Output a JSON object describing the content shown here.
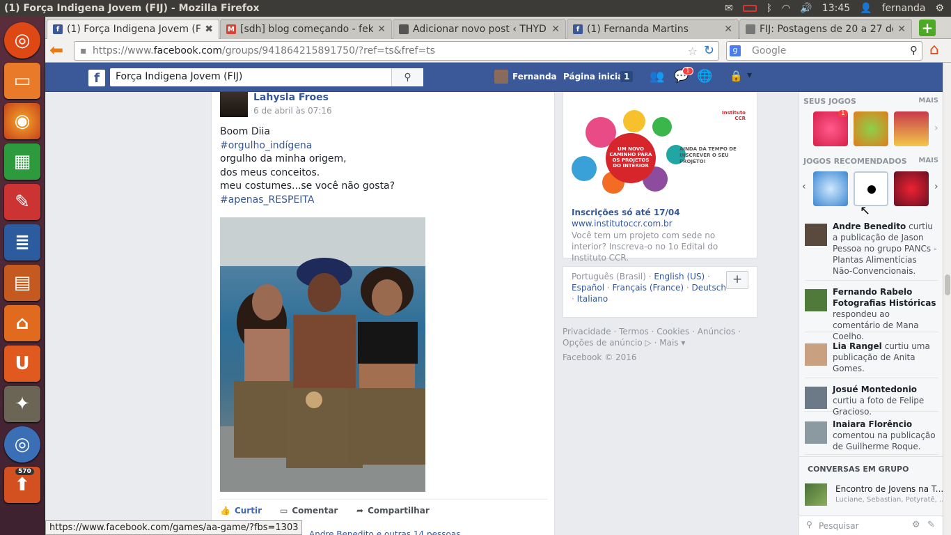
{
  "window": {
    "title": "(1) Força Indigena Jovem (FIJ) - Mozilla Firefox"
  },
  "indicators": {
    "time": "13:45",
    "user": "fernanda"
  },
  "tabs": [
    {
      "label": "(1) Força Indigena Jovem (FIJ)",
      "color": "#3b5998"
    },
    {
      "label": "[sdh] blog começando - fek...",
      "color": "#d44638"
    },
    {
      "label": "Adicionar novo post ‹ THYD...",
      "color": "#555555"
    },
    {
      "label": "(1) Fernanda Martins",
      "color": "#3b5998"
    },
    {
      "label": "FIJ: Postagens de 20 a 27 de...",
      "color": "#777777"
    }
  ],
  "navbar": {
    "url_pre": "https://www.",
    "url_domain": "facebook.com",
    "url_post": "/groups/941864215891750/?ref=ts&fref=ts",
    "search_placeholder": "Google"
  },
  "fb": {
    "search_value": "Força Indigena Jovem (FIJ)",
    "user": "Fernanda",
    "home": "Página inicial",
    "home_count": "1",
    "notif_count": "1"
  },
  "post": {
    "author": "Lahysla Froes",
    "date": "6 de abril às 07:16",
    "lines": [
      "Boom Diia",
      "#orgulho_indígena",
      "orgulho da minha origem,",
      "dos meus conceitos.",
      "meu costumes...se você não gosta?",
      "#apenas_RESPEITA"
    ],
    "like": "Curtir",
    "comment": "Comentar",
    "share": "Compartilhar",
    "likers": "Andre Benedito e outras 14 pessoas"
  },
  "ad": {
    "banner_big": "UM NOVO CAMINHO PARA OS PROJETOS DO INTERIOR",
    "banner_side": "AINDA DÁ TEMPO DE INSCREVER O SEU PROJETO!",
    "brand": "Instituto CCR",
    "title": "Inscrições só até 17/04",
    "url": "www.institutoccr.com.br",
    "desc": "Você tem um projeto com sede no interior? Inscreva-o no 1o Edital do Instituto CCR."
  },
  "languages": {
    "current": "Português (Brasil)",
    "others": [
      "English (US)",
      "Español",
      "Français (France)",
      "Deutsch",
      "Italiano"
    ]
  },
  "footer": {
    "links": [
      "Privacidade",
      "Termos",
      "Cookies",
      "Anúncios",
      "Opções de anúncio",
      "Mais"
    ],
    "copyright": "Facebook © 2016"
  },
  "sidebar": {
    "my_games": "SEUS JOGOS",
    "recommended": "JOGOS RECOMENDADOS",
    "more": "MAIS",
    "game_badge": "1",
    "feed": [
      {
        "name": "Andre Benedito",
        "text": "curtiu a publicação de Jason Pessoa no grupo PANCs - Plantas Alimentícias Não-Convencionais."
      },
      {
        "name": "Fernando Rabelo Fotografias Históricas",
        "text": "respondeu ao comentário de Mana Coelho."
      },
      {
        "name": "Lia Rangel",
        "text": "curtiu uma publicação de Anita Gomes."
      },
      {
        "name": "Josué Montedonio",
        "text": "curtiu a foto de Felipe Gracioso."
      },
      {
        "name": "Inaiara Florêncio",
        "text": "comentou na publicação de Guilherme Roque."
      }
    ],
    "group_chats": "CONVERSAS EM GRUPO",
    "chat": {
      "title": "Encontro de Jovens na T...",
      "members": "Luciane, Sebastian, Potyratê, ..."
    },
    "chat_search": "Pesquisar"
  },
  "statusbar": "https://www.facebook.com/games/aa-game/?fbs=1303",
  "launcher_badge": "570"
}
